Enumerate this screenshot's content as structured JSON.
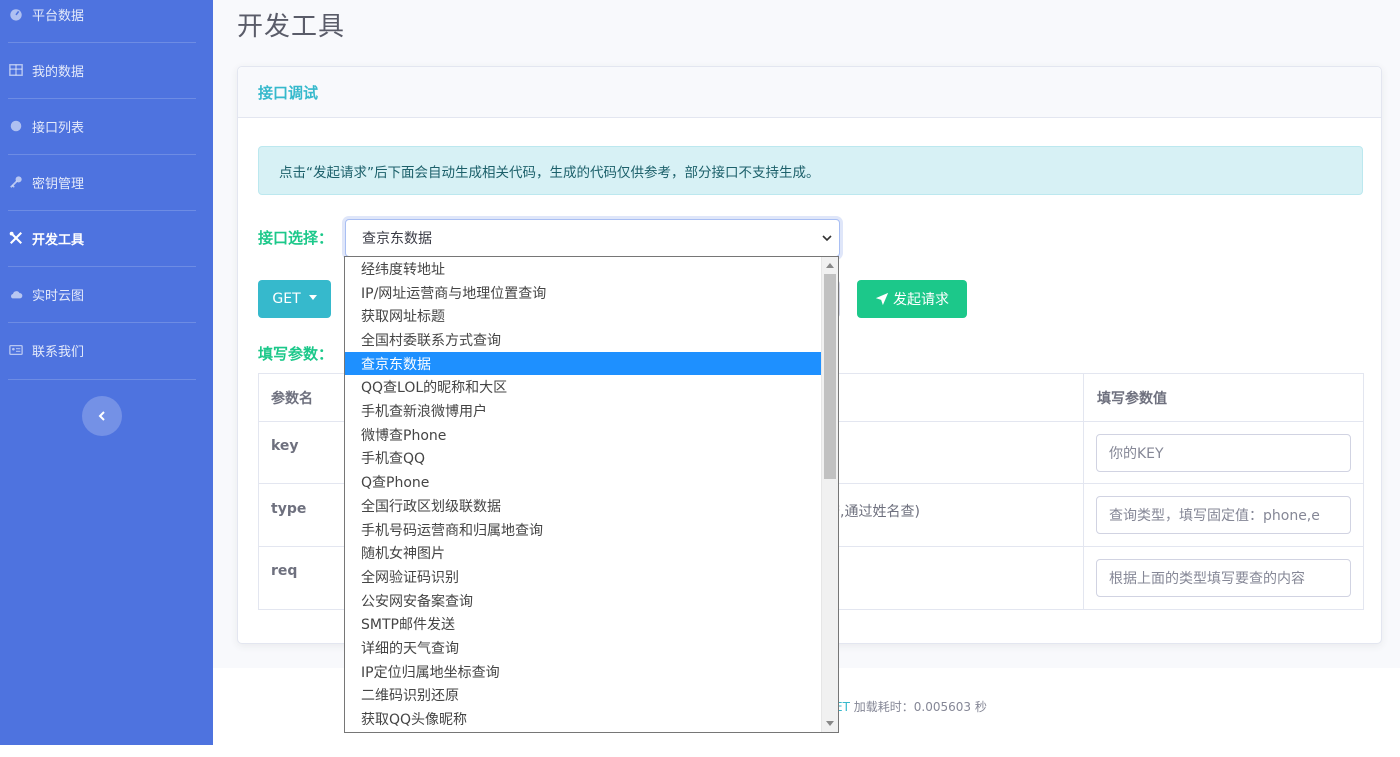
{
  "sidebar": {
    "items": [
      {
        "label": "平台数据",
        "icon": "dashboard-icon"
      },
      {
        "label": "我的数据",
        "icon": "table-icon"
      },
      {
        "label": "接口列表",
        "icon": "circle-icon"
      },
      {
        "label": "密钥管理",
        "icon": "key-icon"
      },
      {
        "label": "开发工具",
        "icon": "tools-icon",
        "active": true
      },
      {
        "label": "实时云图",
        "icon": "cloud-icon"
      },
      {
        "label": "联系我们",
        "icon": "contact-card-icon"
      }
    ]
  },
  "page": {
    "title": "开发工具"
  },
  "card": {
    "header": "接口调试",
    "alert": "点击“发起请求”后下面会自动生成相关代码，生成的代码仅供参考，部分接口不支持生成。",
    "select_label": "接口选择：",
    "selected_api": "查京东数据",
    "method": "GET",
    "send_label": "发起请求",
    "params_label": "填写参数："
  },
  "params_table": {
    "headers": [
      "参数名",
      "填写参数值"
    ],
    "rows": [
      {
        "name": "key",
        "desc": "",
        "placeholder": "你的KEY"
      },
      {
        "name": "type",
        "desc": "查,通过姓名查)",
        "placeholder": "查询类型，填写固定值：phone,e"
      },
      {
        "name": "req",
        "desc": "",
        "placeholder": "根据上面的类型填写要查的内容"
      }
    ]
  },
  "dropdown": {
    "options": [
      "经纬度转地址",
      "IP/网址运营商与地理位置查询",
      "获取网址标题",
      "全国村委联系方式查询",
      "查京东数据",
      "QQ查LOL的昵称和大区",
      "手机查新浪微博用户",
      "微博查Phone",
      "手机查QQ",
      "Q查Phone",
      "全国行政区划级联数据",
      "手机号码运营商和归属地查询",
      "随机女神图片",
      "全网验证码识别",
      "公安网安备案查询",
      "SMTP邮件发送",
      "详细的天气查询",
      "IP定位归属地坐标查询",
      "二维码识别还原",
      "获取QQ头像昵称"
    ],
    "selected_index": 4
  },
  "footer": {
    "link_fragment": "ET",
    "load_text": "加载耗时：0.005603 秒"
  }
}
